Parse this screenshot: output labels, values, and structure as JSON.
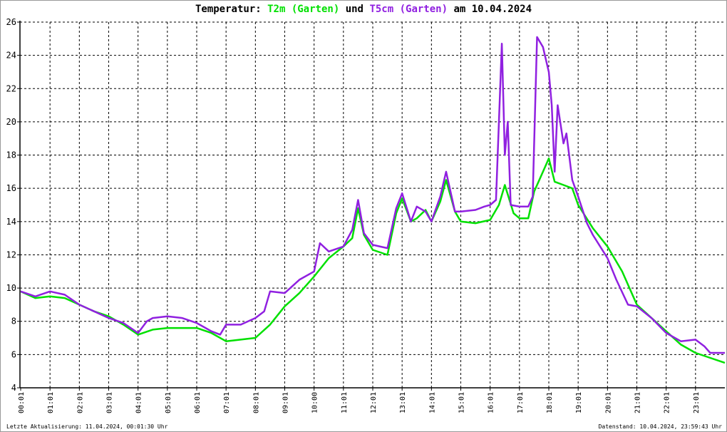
{
  "chart_data": {
    "type": "line",
    "title": {
      "prefix": "Temperatur:",
      "series1": "T2m (Garten)",
      "mid": "und",
      "series2": "T5cm (Garten)",
      "suffix": "am 10.04.2024"
    },
    "xlabel": "",
    "ylabel": "",
    "ylim": [
      4,
      26
    ],
    "xlim": [
      0,
      24
    ],
    "yticks": [
      4,
      6,
      8,
      10,
      12,
      14,
      16,
      18,
      20,
      22,
      24,
      26
    ],
    "xtick_labels": [
      "00:01",
      "01:01",
      "02:01",
      "03:01",
      "04:01",
      "05:01",
      "06:01",
      "07:01",
      "08:01",
      "09:01",
      "10:00",
      "11:01",
      "12:01",
      "13:01",
      "14:01",
      "15:01",
      "16:01",
      "17:01",
      "18:01",
      "19:01",
      "20:01",
      "21:01",
      "22:01",
      "23:01"
    ],
    "grid": true,
    "series": [
      {
        "name": "T2m (Garten)",
        "color": "#00e000",
        "x": [
          0,
          0.5,
          1,
          1.5,
          2,
          2.5,
          3,
          3.5,
          4,
          4.5,
          5,
          5.5,
          6,
          6.5,
          7,
          7.5,
          8,
          8.5,
          9,
          9.5,
          10,
          10.5,
          11,
          11.3,
          11.5,
          11.7,
          12,
          12.5,
          12.8,
          13,
          13.3,
          13.5,
          13.8,
          14,
          14.3,
          14.5,
          14.8,
          15,
          15.5,
          16,
          16.3,
          16.5,
          16.8,
          17,
          17.3,
          17.5,
          17.8,
          18,
          18.2,
          18.5,
          18.8,
          19,
          19.5,
          20,
          20.5,
          21,
          21.5,
          22,
          22.5,
          23,
          23.5,
          24
        ],
        "y": [
          9.8,
          9.4,
          9.5,
          9.4,
          9.0,
          8.6,
          8.3,
          7.8,
          7.2,
          7.5,
          7.6,
          7.6,
          7.6,
          7.3,
          6.8,
          6.9,
          7.0,
          7.8,
          8.9,
          9.7,
          10.7,
          11.8,
          12.5,
          13.0,
          14.8,
          13.2,
          12.3,
          12.0,
          14.5,
          15.4,
          14.0,
          14.2,
          14.7,
          14.0,
          15.2,
          16.5,
          14.6,
          14.0,
          13.9,
          14.1,
          15.0,
          16.2,
          14.5,
          14.2,
          14.2,
          15.8,
          17.0,
          17.8,
          16.4,
          16.2,
          16.0,
          15.0,
          13.6,
          12.5,
          11.0,
          9.0,
          8.2,
          7.4,
          6.6,
          6.1,
          5.8,
          5.5
        ]
      },
      {
        "name": "T5cm (Garten)",
        "color": "#9020e0",
        "x": [
          0,
          0.5,
          1,
          1.5,
          2,
          2.5,
          3,
          3.5,
          4,
          4.3,
          4.5,
          5,
          5.5,
          6,
          6.5,
          6.8,
          7,
          7.5,
          8,
          8.3,
          8.5,
          9,
          9.5,
          10,
          10.2,
          10.5,
          11,
          11.3,
          11.5,
          11.7,
          12,
          12.5,
          12.8,
          13,
          13.3,
          13.5,
          13.8,
          14,
          14.3,
          14.5,
          14.8,
          15,
          15.5,
          15.8,
          16,
          16.2,
          16.4,
          16.5,
          16.6,
          16.7,
          17,
          17.3,
          17.45,
          17.6,
          17.8,
          18,
          18.1,
          18.2,
          18.3,
          18.5,
          18.6,
          18.8,
          19,
          19.3,
          19.5,
          20,
          20.3,
          20.7,
          21,
          21.5,
          22,
          22.5,
          23,
          23.3,
          23.5,
          24
        ],
        "y": [
          9.8,
          9.5,
          9.8,
          9.6,
          9.0,
          8.6,
          8.2,
          7.9,
          7.3,
          8.0,
          8.2,
          8.3,
          8.2,
          7.9,
          7.4,
          7.2,
          7.8,
          7.8,
          8.2,
          8.6,
          9.8,
          9.7,
          10.5,
          11.0,
          12.7,
          12.2,
          12.5,
          13.5,
          15.3,
          13.3,
          12.6,
          12.4,
          14.8,
          15.7,
          14.0,
          14.9,
          14.6,
          14.0,
          15.5,
          17.0,
          14.6,
          14.6,
          14.7,
          14.9,
          15.0,
          15.3,
          24.7,
          18.0,
          20.0,
          15.0,
          14.9,
          14.9,
          15.5,
          25.1,
          24.5,
          23.0,
          21.0,
          17.0,
          21.0,
          18.7,
          19.3,
          16.5,
          15.5,
          13.9,
          13.2,
          11.8,
          10.5,
          9.0,
          8.9,
          8.2,
          7.3,
          6.8,
          6.9,
          6.5,
          6.1,
          6.1
        ]
      }
    ]
  },
  "footer": {
    "left": "Letzte Aktualisierung: 11.04.2024, 00:01:30 Uhr",
    "right": "Datenstand: 10.04.2024, 23:59:43 Uhr"
  }
}
